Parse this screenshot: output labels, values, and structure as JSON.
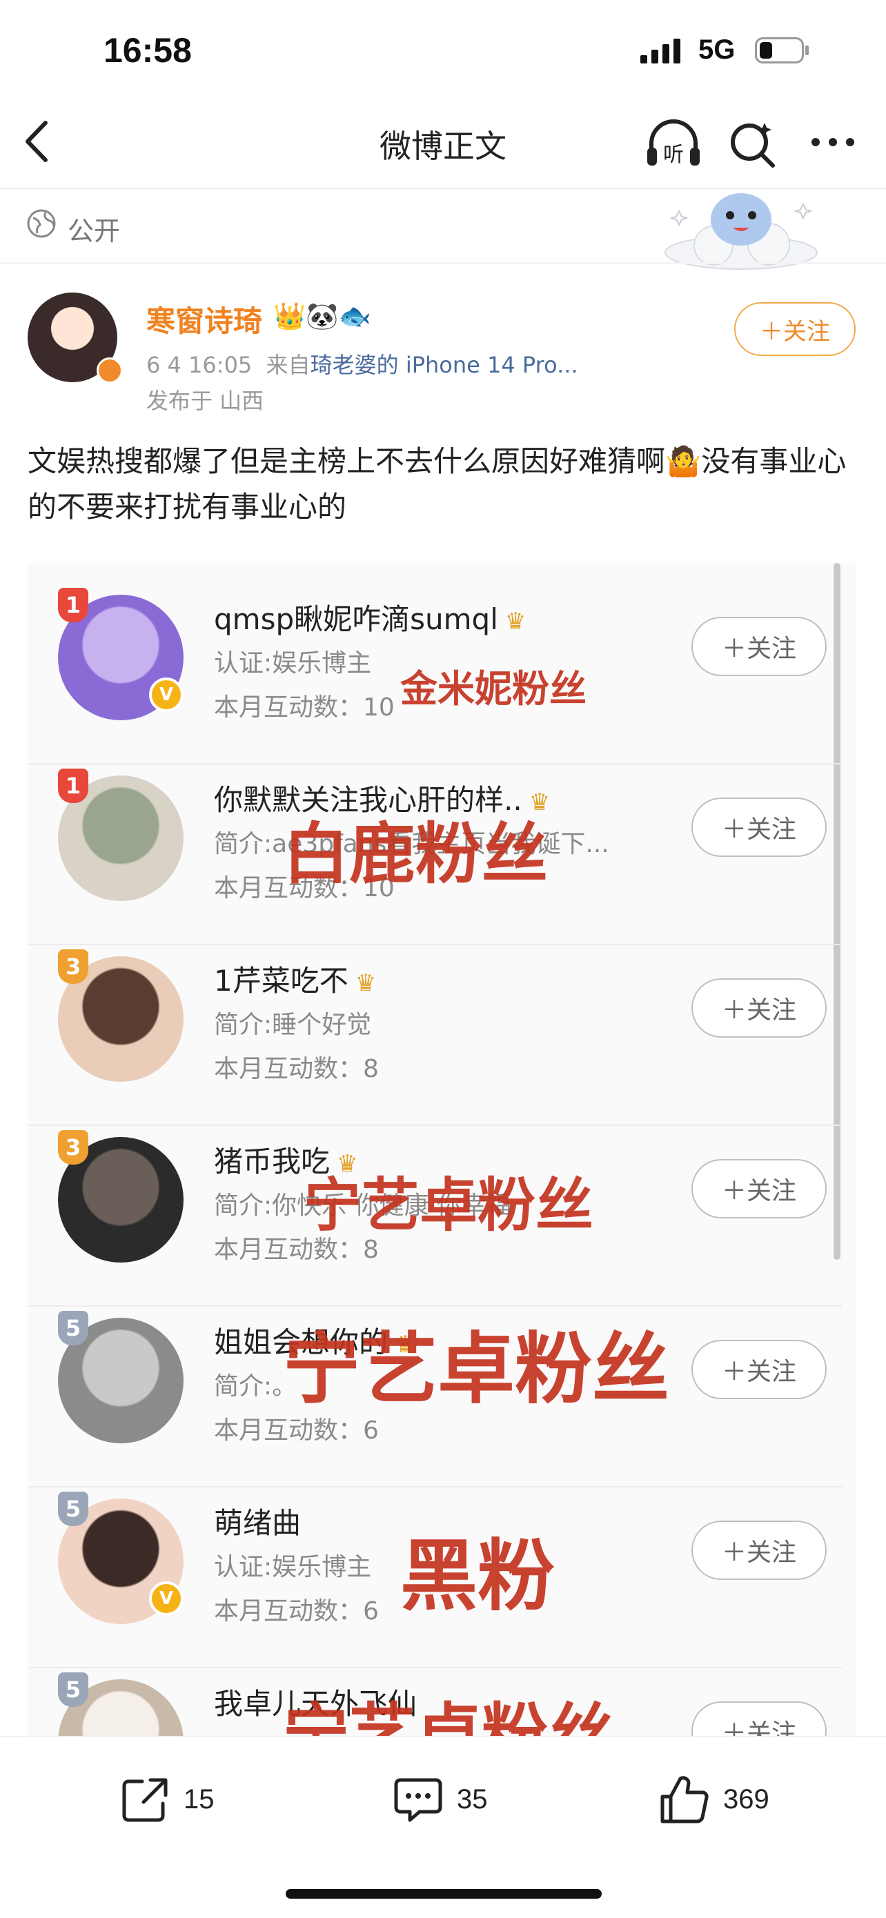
{
  "status_bar": {
    "time": "16:58",
    "network": "5G"
  },
  "nav": {
    "title": "微博正文",
    "listen_label": "听"
  },
  "visibility": "公开",
  "author": {
    "name": "寒窗诗琦",
    "emojis": "👑🐼🐟",
    "date_time": "6  4 16:05",
    "source_prefix": "来自",
    "source": "琦老婆的 iPhone 14 Pro...",
    "location": "发布于 山西",
    "follow_label": "＋关注"
  },
  "post": {
    "text_1": "文娱热搜都爆了但是主榜上不去什么原因好难猜啊",
    "emoji": "🤷",
    "text_2": "没有事业心的不要来打扰有事业心的"
  },
  "fan_list": {
    "follow_label": "＋关注",
    "items": [
      {
        "rank": "1",
        "rank_color": "#e8473b",
        "name": "qmsp瞅妮咋滴sumql",
        "desc": "认证:娱乐博主",
        "count": "本月互动数：10",
        "verified": true,
        "avatar_colors": [
          "#8a6bd6",
          "#c7b2f0"
        ],
        "overlay": "金米妮粉丝"
      },
      {
        "rank": "1",
        "rank_color": "#e8473b",
        "name": "你默默关注我心肝的样..",
        "desc": "简介:ae3pfans看我主页当我诞下...",
        "count": "本月互动数：10",
        "verified": false,
        "avatar_colors": [
          "#d9d2c7",
          "#9aa58f"
        ],
        "overlay": "白鹿粉丝"
      },
      {
        "rank": "3",
        "rank_color": "#f0a030",
        "name": "1芹菜吃不",
        "desc": "简介:睡个好觉",
        "count": "本月互动数：8",
        "verified": false,
        "avatar_colors": [
          "#e9cdb8",
          "#5a3c30"
        ],
        "overlay": ""
      },
      {
        "rank": "3",
        "rank_color": "#f0a030",
        "name": "猪币我吃",
        "desc": "简介:你快乐 你健康 你幸福",
        "count": "本月互动数：8",
        "verified": false,
        "avatar_colors": [
          "#2b2b2b",
          "#6a5e58"
        ],
        "overlay": "宁艺卓粉丝"
      },
      {
        "rank": "5",
        "rank_color": "#9aa6b8",
        "name": "姐姐会想你的",
        "desc": "简介:。",
        "count": "本月互动数：6",
        "verified": false,
        "avatar_colors": [
          "#8b8b8b",
          "#c9c9c9"
        ],
        "overlay": "宁艺卓粉丝"
      },
      {
        "rank": "5",
        "rank_color": "#9aa6b8",
        "name": "萌绪曲",
        "desc": "认证:娱乐博主",
        "count": "本月互动数：6",
        "verified": true,
        "avatar_colors": [
          "#f1d3c4",
          "#3b2a26"
        ],
        "overlay": "黑粉"
      },
      {
        "rank": "5",
        "rank_color": "#9aa6b8",
        "name": "我卓儿天外飞仙",
        "desc": "",
        "count": "",
        "verified": false,
        "avatar_colors": [
          "#c9b9a8",
          "#f4efe8"
        ],
        "overlay": "宁艺卓粉丝"
      }
    ]
  },
  "actions": {
    "repost_count": "15",
    "comment_count": "35",
    "like_count": "369"
  }
}
